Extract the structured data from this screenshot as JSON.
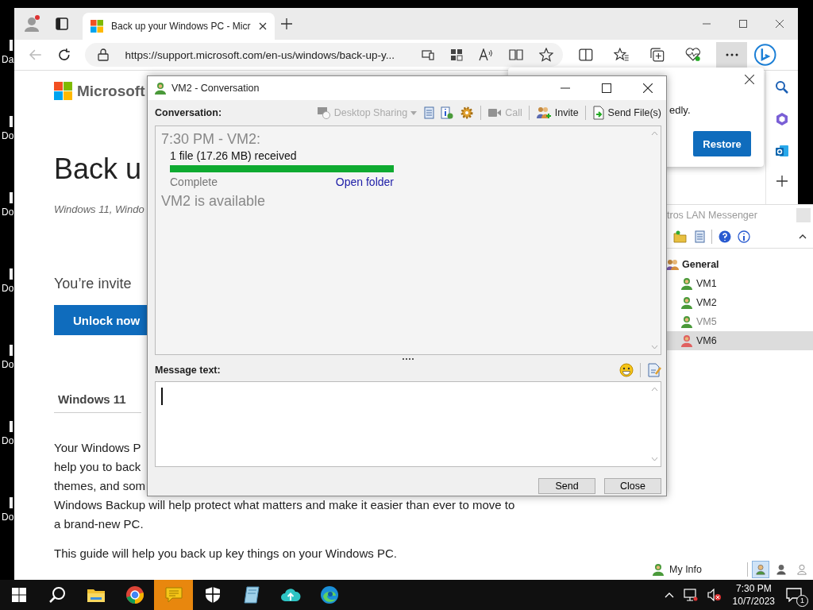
{
  "desktop": {
    "icons": [
      {
        "label": "Da"
      },
      {
        "label": "Do"
      },
      {
        "label": "Do"
      },
      {
        "label": "Do"
      },
      {
        "label": "Do"
      },
      {
        "label": "Do"
      },
      {
        "label": "Do"
      }
    ]
  },
  "browser": {
    "tab": {
      "title": "Back up your Windows PC - Micr",
      "selected": true
    },
    "url": "https://support.microsoft.com/en-us/windows/back-up-y...",
    "page": {
      "brand": "Microsoft",
      "heading": "Back u",
      "subtitle": "Windows 11, Windo",
      "invite": "You’re invite",
      "unlock_button": "Unlock now",
      "section_tab": "Windows 11",
      "paragraphs": [
        "Your Windows P",
        "help you to back",
        "themes, and som",
        "Windows Backup will help protect what matters and make it easier than ever to move to",
        "a brand-new PC."
      ],
      "guide": "This guide will help you back up key things on your Windows PC."
    },
    "popup": {
      "text": "edly.",
      "button": "Restore"
    }
  },
  "conversation": {
    "title": "VM2 - Conversation",
    "label": "Conversation:",
    "toolbar": [
      {
        "kind": "screen",
        "label": "Desktop Sharing",
        "disabled": true,
        "dropdown": true
      },
      {
        "kind": "notes",
        "disabled": false
      },
      {
        "kind": "info",
        "disabled": false
      },
      {
        "kind": "gear",
        "disabled": false
      },
      {
        "kind": "camera",
        "label": "Call",
        "disabled": true,
        "dropdown": false
      },
      {
        "kind": "people",
        "label": "Invite",
        "disabled": false,
        "dropdown": false
      },
      {
        "kind": "file",
        "label": "Send File(s)",
        "disabled": false,
        "dropdown": false
      }
    ],
    "messages": [
      {
        "kind": "header",
        "text": "7:30 PM - VM2:"
      },
      {
        "kind": "transfer",
        "text": "1 file (17.26 MB) received",
        "level": 1,
        "status": "Complete",
        "link": "Open folder"
      },
      {
        "kind": "status",
        "text": "VM2 is available"
      }
    ],
    "message_label": "Message text:",
    "buttons": [
      "Send",
      "Close"
    ]
  },
  "messenger": {
    "title": "tros LAN Messenger",
    "groups": [
      {
        "name": "General",
        "contacts": [
          {
            "name": "VM1",
            "color": "#4a9a3a",
            "disabled": false,
            "selected": false
          },
          {
            "name": "VM2",
            "color": "#4a9a3a",
            "disabled": false,
            "selected": false
          },
          {
            "name": "VM5",
            "color": "#4a9a3a",
            "disabled": true,
            "selected": false
          },
          {
            "name": "VM6",
            "color": "#e06060",
            "disabled": false,
            "selected": true
          }
        ]
      }
    ],
    "my_info": "My Info",
    "status_buttons": [
      {
        "kind": "online",
        "selected": true
      },
      {
        "kind": "busy",
        "selected": false
      },
      {
        "kind": "offline",
        "selected": false
      }
    ]
  },
  "taskbar": {
    "apps": [
      {
        "kind": "folder",
        "selected": false
      },
      {
        "kind": "chrome",
        "selected": false
      },
      {
        "kind": "chat",
        "selected": true
      },
      {
        "kind": "shield",
        "selected": false
      },
      {
        "kind": "note",
        "selected": false
      },
      {
        "kind": "cloud",
        "selected": false
      },
      {
        "kind": "edge",
        "selected": false
      }
    ],
    "time": "7:30 PM",
    "date": "10/7/2023",
    "notifications": "1"
  }
}
